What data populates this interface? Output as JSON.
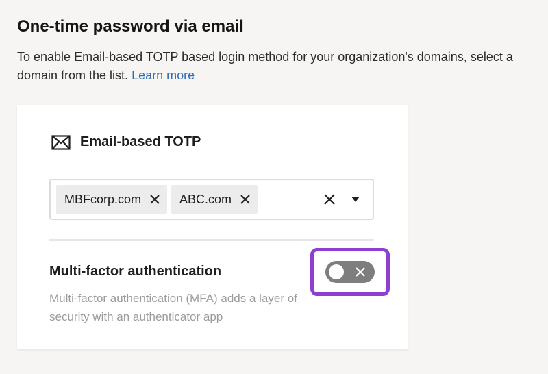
{
  "section": {
    "title": "One-time password via email",
    "description": "To enable Email-based TOTP based login method for your organization's domains, select a domain from the list.",
    "learn_more": "Learn more"
  },
  "card": {
    "icon": "envelope-icon",
    "title": "Email-based TOTP",
    "domains": [
      "MBFcorp.com",
      "ABC.com"
    ],
    "mfa": {
      "title": "Multi-factor authentication",
      "description": "Multi-factor authentication (MFA) adds a layer of security with an authenticator app",
      "enabled": false
    }
  },
  "colors": {
    "link": "#2f6db0",
    "highlight": "#8d3fd1",
    "toggle_off": "#7e7e7e"
  }
}
